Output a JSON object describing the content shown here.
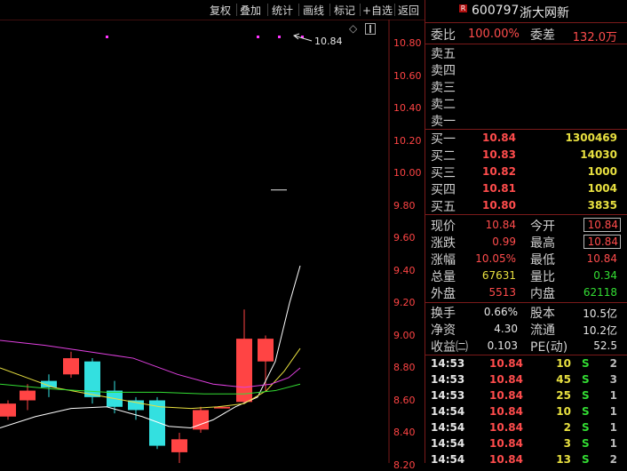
{
  "toolbar": {
    "buttons": [
      "复权",
      "叠加",
      "统计",
      "画线",
      "标记",
      "+自选",
      "返回"
    ]
  },
  "chart": {
    "price_ticks": [
      "10.80",
      "10.60",
      "10.40",
      "10.20",
      "10.00",
      "9.80",
      "9.60",
      "9.40",
      "9.20",
      "9.00",
      "8.80",
      "8.60",
      "8.40",
      "8.20"
    ],
    "high_label": "10.84",
    "colors": {
      "up": "#ff4444",
      "down": "#33e0e0",
      "ma5": "#ffffff",
      "ma10": "#e8e040",
      "ma20": "#e040e0",
      "ma30": "#33dd33"
    }
  },
  "chart_data": {
    "type": "candlestick",
    "ylim": [
      8.2,
      10.9
    ],
    "candles": [
      {
        "open": 8.5,
        "close": 8.58,
        "high": 8.6,
        "low": 8.48
      },
      {
        "open": 8.6,
        "close": 8.66,
        "high": 8.7,
        "low": 8.54
      },
      {
        "open": 8.72,
        "close": 8.68,
        "high": 8.76,
        "low": 8.62
      },
      {
        "open": 8.76,
        "close": 8.86,
        "high": 8.9,
        "low": 8.74
      },
      {
        "open": 8.84,
        "close": 8.62,
        "high": 8.86,
        "low": 8.58
      },
      {
        "open": 8.66,
        "close": 8.56,
        "high": 8.72,
        "low": 8.52
      },
      {
        "open": 8.6,
        "close": 8.54,
        "high": 8.62,
        "low": 8.48
      },
      {
        "open": 8.6,
        "close": 8.32,
        "high": 8.62,
        "low": 8.3
      },
      {
        "open": 8.28,
        "close": 8.36,
        "high": 8.4,
        "low": 8.2
      },
      {
        "open": 8.42,
        "close": 8.54,
        "high": 8.56,
        "low": 8.4
      },
      {
        "open": 8.55,
        "close": 8.56,
        "high": 8.56,
        "low": 8.55
      },
      {
        "open": 8.59,
        "close": 8.98,
        "high": 9.16,
        "low": 8.58
      },
      {
        "open": 8.84,
        "close": 8.98,
        "high": 9.0,
        "low": 8.66
      },
      {
        "open": 10.84,
        "close": 10.84,
        "high": 10.84,
        "low": 10.84
      }
    ]
  },
  "quote": {
    "code": "600797",
    "name": "浙大网新",
    "wb_label": "委比",
    "wb_value": "100.00%",
    "wc_label": "委差",
    "wc_value": "132.0万",
    "asks": [
      {
        "label": "卖五",
        "price": "",
        "vol": ""
      },
      {
        "label": "卖四",
        "price": "",
        "vol": ""
      },
      {
        "label": "卖三",
        "price": "",
        "vol": ""
      },
      {
        "label": "卖二",
        "price": "",
        "vol": ""
      },
      {
        "label": "卖一",
        "price": "",
        "vol": ""
      }
    ],
    "bids": [
      {
        "label": "买一",
        "price": "10.84",
        "vol": "1300469"
      },
      {
        "label": "买二",
        "price": "10.83",
        "vol": "14030"
      },
      {
        "label": "买三",
        "price": "10.82",
        "vol": "1000"
      },
      {
        "label": "买四",
        "price": "10.81",
        "vol": "1004"
      },
      {
        "label": "买五",
        "price": "10.80",
        "vol": "3835"
      }
    ],
    "stats": {
      "xj_l": "现价",
      "xj": "10.84",
      "jk_l": "今开",
      "jk": "10.84",
      "zd_l": "涨跌",
      "zd": "0.99",
      "zg_l": "最高",
      "zg": "10.84",
      "zf_l": "涨幅",
      "zf": "10.05%",
      "zdi_l": "最低",
      "zdi": "10.84",
      "zl_l": "总量",
      "zl": "67631",
      "lb_l": "量比",
      "lb": "0.34",
      "wp_l": "外盘",
      "wp": "5513",
      "np_l": "内盘",
      "np": "62118"
    },
    "fin": {
      "hs_l": "换手",
      "hs": "0.66%",
      "gb_l": "股本",
      "gb": "10.5亿",
      "jz_l": "净资",
      "jz": "4.30",
      "lt_l": "流通",
      "lt": "10.2亿",
      "sy_l": "收益㈡",
      "sy": "0.103",
      "pe_l": "PE(动)",
      "pe": "52.5"
    },
    "ticks": [
      {
        "time": "14:53",
        "price": "10.84",
        "vol": "10",
        "side": "S",
        "n": "2"
      },
      {
        "time": "14:53",
        "price": "10.84",
        "vol": "45",
        "side": "S",
        "n": "3"
      },
      {
        "time": "14:53",
        "price": "10.84",
        "vol": "25",
        "side": "S",
        "n": "1"
      },
      {
        "time": "14:54",
        "price": "10.84",
        "vol": "10",
        "side": "S",
        "n": "1"
      },
      {
        "time": "14:54",
        "price": "10.84",
        "vol": "2",
        "side": "S",
        "n": "1"
      },
      {
        "time": "14:54",
        "price": "10.84",
        "vol": "3",
        "side": "S",
        "n": "1"
      },
      {
        "time": "14:54",
        "price": "10.84",
        "vol": "13",
        "side": "S",
        "n": "2"
      }
    ]
  }
}
